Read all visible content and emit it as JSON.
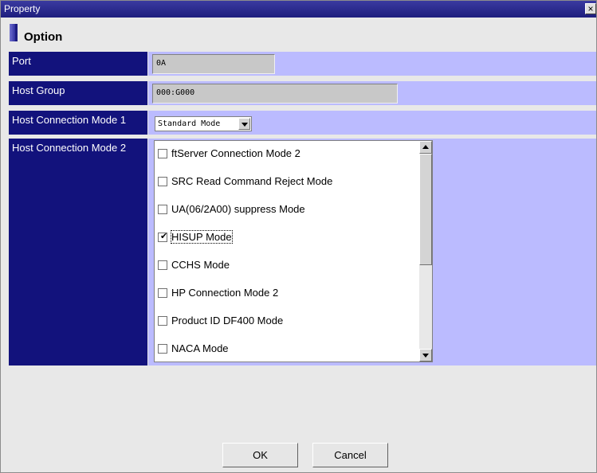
{
  "window": {
    "title": "Property",
    "close_glyph": "×"
  },
  "section": {
    "title": "Option"
  },
  "fields": {
    "port": {
      "label": "Port",
      "value": "0A"
    },
    "host_group": {
      "label": "Host Group",
      "value": "000:G000"
    },
    "mode1": {
      "label": "Host Connection Mode 1",
      "selected": "Standard Mode"
    },
    "mode2": {
      "label": "Host Connection Mode 2",
      "options": [
        {
          "label": "ftServer Connection Mode 2",
          "checked": false
        },
        {
          "label": "SRC Read Command Reject Mode",
          "checked": false
        },
        {
          "label": "UA(06/2A00) suppress Mode",
          "checked": false
        },
        {
          "label": "HISUP Mode",
          "checked": true
        },
        {
          "label": "CCHS Mode",
          "checked": false
        },
        {
          "label": "HP Connection Mode 2",
          "checked": false
        },
        {
          "label": "Product ID DF400 Mode",
          "checked": false
        },
        {
          "label": "NACA Mode",
          "checked": false
        }
      ]
    }
  },
  "buttons": {
    "ok": "OK",
    "cancel": "Cancel"
  },
  "colors": {
    "label_bg": "#12127c",
    "value_bg": "#bbbbff",
    "titlebar": "#1e1e7e"
  }
}
